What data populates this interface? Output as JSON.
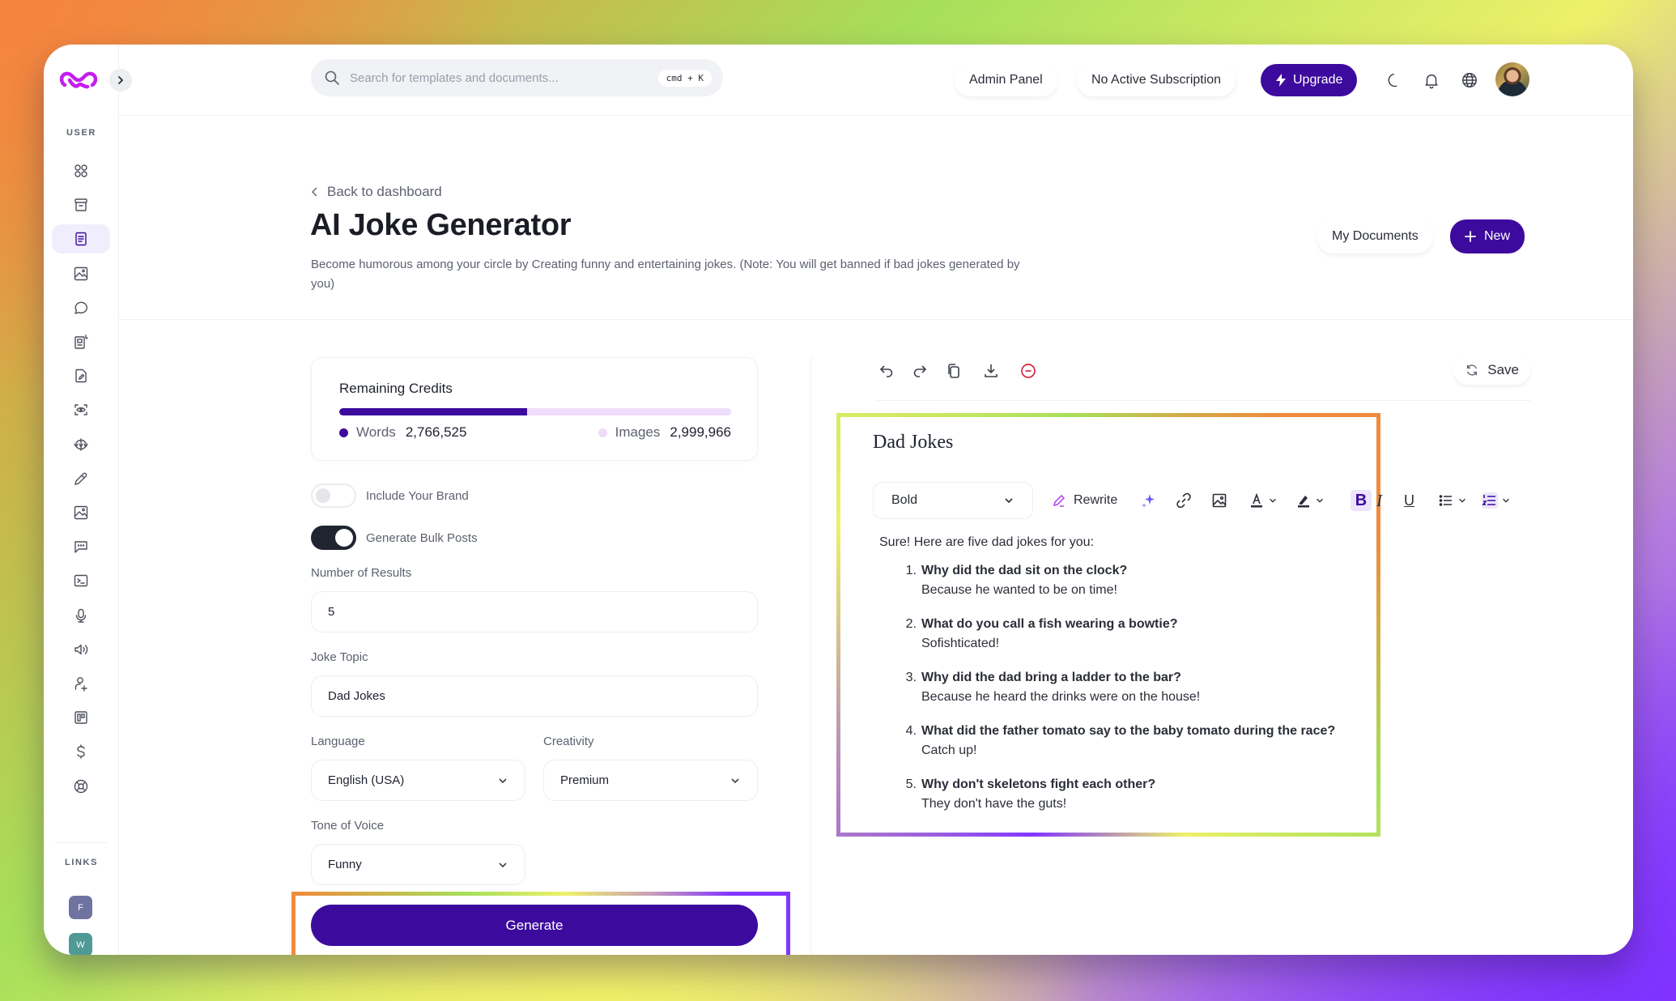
{
  "sidebar": {
    "section_user": "USER",
    "section_links": "LINKS",
    "items": [
      {
        "name": "dashboard",
        "icon": "grid-icon",
        "active": false
      },
      {
        "name": "documents-archive",
        "icon": "archive-icon",
        "active": false
      },
      {
        "name": "ai-writer",
        "icon": "document-icon",
        "active": true
      },
      {
        "name": "ai-image",
        "icon": "image-icon",
        "active": false
      },
      {
        "name": "ai-chat",
        "icon": "chat-bubble-icon",
        "active": false
      },
      {
        "name": "ai-article",
        "icon": "article-sparkle-icon",
        "active": false
      },
      {
        "name": "ai-rewriter",
        "icon": "document-edit-icon",
        "active": false
      },
      {
        "name": "ai-vision",
        "icon": "scan-eye-icon",
        "active": false
      },
      {
        "name": "ai-web",
        "icon": "www-icon",
        "active": false
      },
      {
        "name": "ai-editor",
        "icon": "pen-icon",
        "active": false
      },
      {
        "name": "ai-image-2",
        "icon": "image-icon",
        "active": false
      },
      {
        "name": "ai-chat-2",
        "icon": "chat-dots-icon",
        "active": false
      },
      {
        "name": "ai-code",
        "icon": "terminal-icon",
        "active": false
      },
      {
        "name": "ai-speech-to-text",
        "icon": "microphone-icon",
        "active": false
      },
      {
        "name": "ai-voiceover",
        "icon": "speaker-icon",
        "active": false
      },
      {
        "name": "affiliates",
        "icon": "user-plus-icon",
        "active": false
      },
      {
        "name": "brand-voice",
        "icon": "kanban-icon",
        "active": false
      },
      {
        "name": "plans",
        "icon": "dollar-icon",
        "active": false
      },
      {
        "name": "support",
        "icon": "lifebuoy-icon",
        "active": false
      }
    ],
    "links": [
      {
        "letter": "F",
        "color": "#6f73a0"
      },
      {
        "letter": "W",
        "color": "#4f9a96"
      }
    ]
  },
  "topbar": {
    "search_placeholder": "Search for templates and documents...",
    "search_shortcut": "cmd + K",
    "admin_panel": "Admin Panel",
    "subscription": "No Active Subscription",
    "upgrade": "Upgrade"
  },
  "header": {
    "back": "Back to dashboard",
    "title": "AI Joke Generator",
    "description": "Become humorous among your circle by Creating funny and entertaining jokes. (Note: You will get banned if bad jokes generated by you)",
    "my_documents": "My Documents",
    "new": "New"
  },
  "credits": {
    "title": "Remaining Credits",
    "words_label": "Words",
    "words_value": "2,766,525",
    "images_label": "Images",
    "images_value": "2,999,966",
    "words_fraction": 0.48
  },
  "form": {
    "include_brand": {
      "label": "Include Your Brand",
      "on": false
    },
    "bulk_posts": {
      "label": "Generate Bulk Posts",
      "on": true
    },
    "results_label": "Number of Results",
    "results_value": "5",
    "topic_label": "Joke Topic",
    "topic_value": "Dad Jokes",
    "language_label": "Language",
    "language_value": "English (USA)",
    "creativity_label": "Creativity",
    "creativity_value": "Premium",
    "tone_label": "Tone of Voice",
    "tone_value": "Funny",
    "generate": "Generate"
  },
  "editor": {
    "save": "Save",
    "doc_title": "Dad Jokes",
    "format_value": "Bold",
    "rewrite": "Rewrite",
    "intro": "Sure! Here are five dad jokes for you:",
    "jokes": [
      {
        "num": "1.",
        "q": "Why did the dad sit on the clock?",
        "a": "Because he wanted to be on time!"
      },
      {
        "num": "2.",
        "q": "What do you call a fish wearing a bowtie?",
        "a": "Sofishticated!"
      },
      {
        "num": "3.",
        "q": "Why did the dad bring a ladder to the bar?",
        "a": "Because he heard the drinks were on the house!"
      },
      {
        "num": "4.",
        "q": "What did the father tomato say to the baby tomato during the race?",
        "a": "Catch up!"
      },
      {
        "num": "5.",
        "q": "Why don't skeletons fight each other?",
        "a": "They don't have the guts!"
      }
    ]
  },
  "colors": {
    "brand": "#3d0a9e",
    "brand_light": "#eedcfb",
    "logo": "#c41ef0",
    "danger": "#d7263d"
  }
}
